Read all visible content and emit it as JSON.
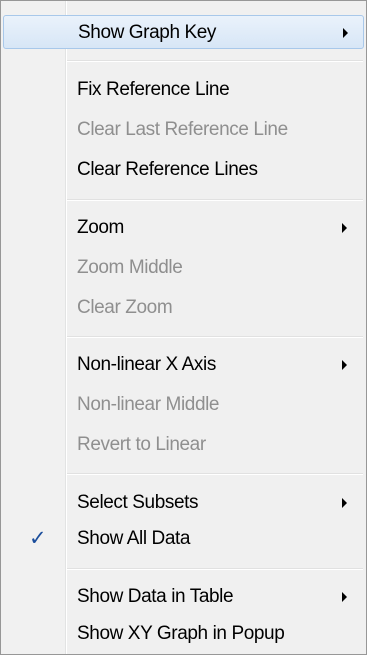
{
  "menu": {
    "items": [
      {
        "label": "Show Graph Key",
        "enabled": true,
        "submenu": true,
        "highlighted": true
      },
      {
        "label": "Fix Reference Line",
        "enabled": true
      },
      {
        "label": "Clear Last Reference Line",
        "enabled": false
      },
      {
        "label": "Clear Reference Lines",
        "enabled": true
      },
      {
        "label": "Zoom",
        "enabled": true,
        "submenu": true
      },
      {
        "label": "Zoom Middle",
        "enabled": false
      },
      {
        "label": "Clear Zoom",
        "enabled": false
      },
      {
        "label": "Non-linear X Axis",
        "enabled": true,
        "submenu": true
      },
      {
        "label": "Non-linear Middle",
        "enabled": false
      },
      {
        "label": "Revert to Linear",
        "enabled": false
      },
      {
        "label": "Select Subsets",
        "enabled": true,
        "submenu": true
      },
      {
        "label": "Show All Data",
        "enabled": true,
        "checked": true
      },
      {
        "label": "Show Data in Table",
        "enabled": true,
        "submenu": true
      },
      {
        "label": "Show XY Graph in Popup",
        "enabled": true
      }
    ],
    "check_glyph": "✓",
    "submenu_icon": "chevron-right-icon",
    "colors": {
      "text": "#000000",
      "disabled_text": "#8f8f8f",
      "highlight": "#d7e6f6",
      "check": "#1b4e9c"
    }
  }
}
